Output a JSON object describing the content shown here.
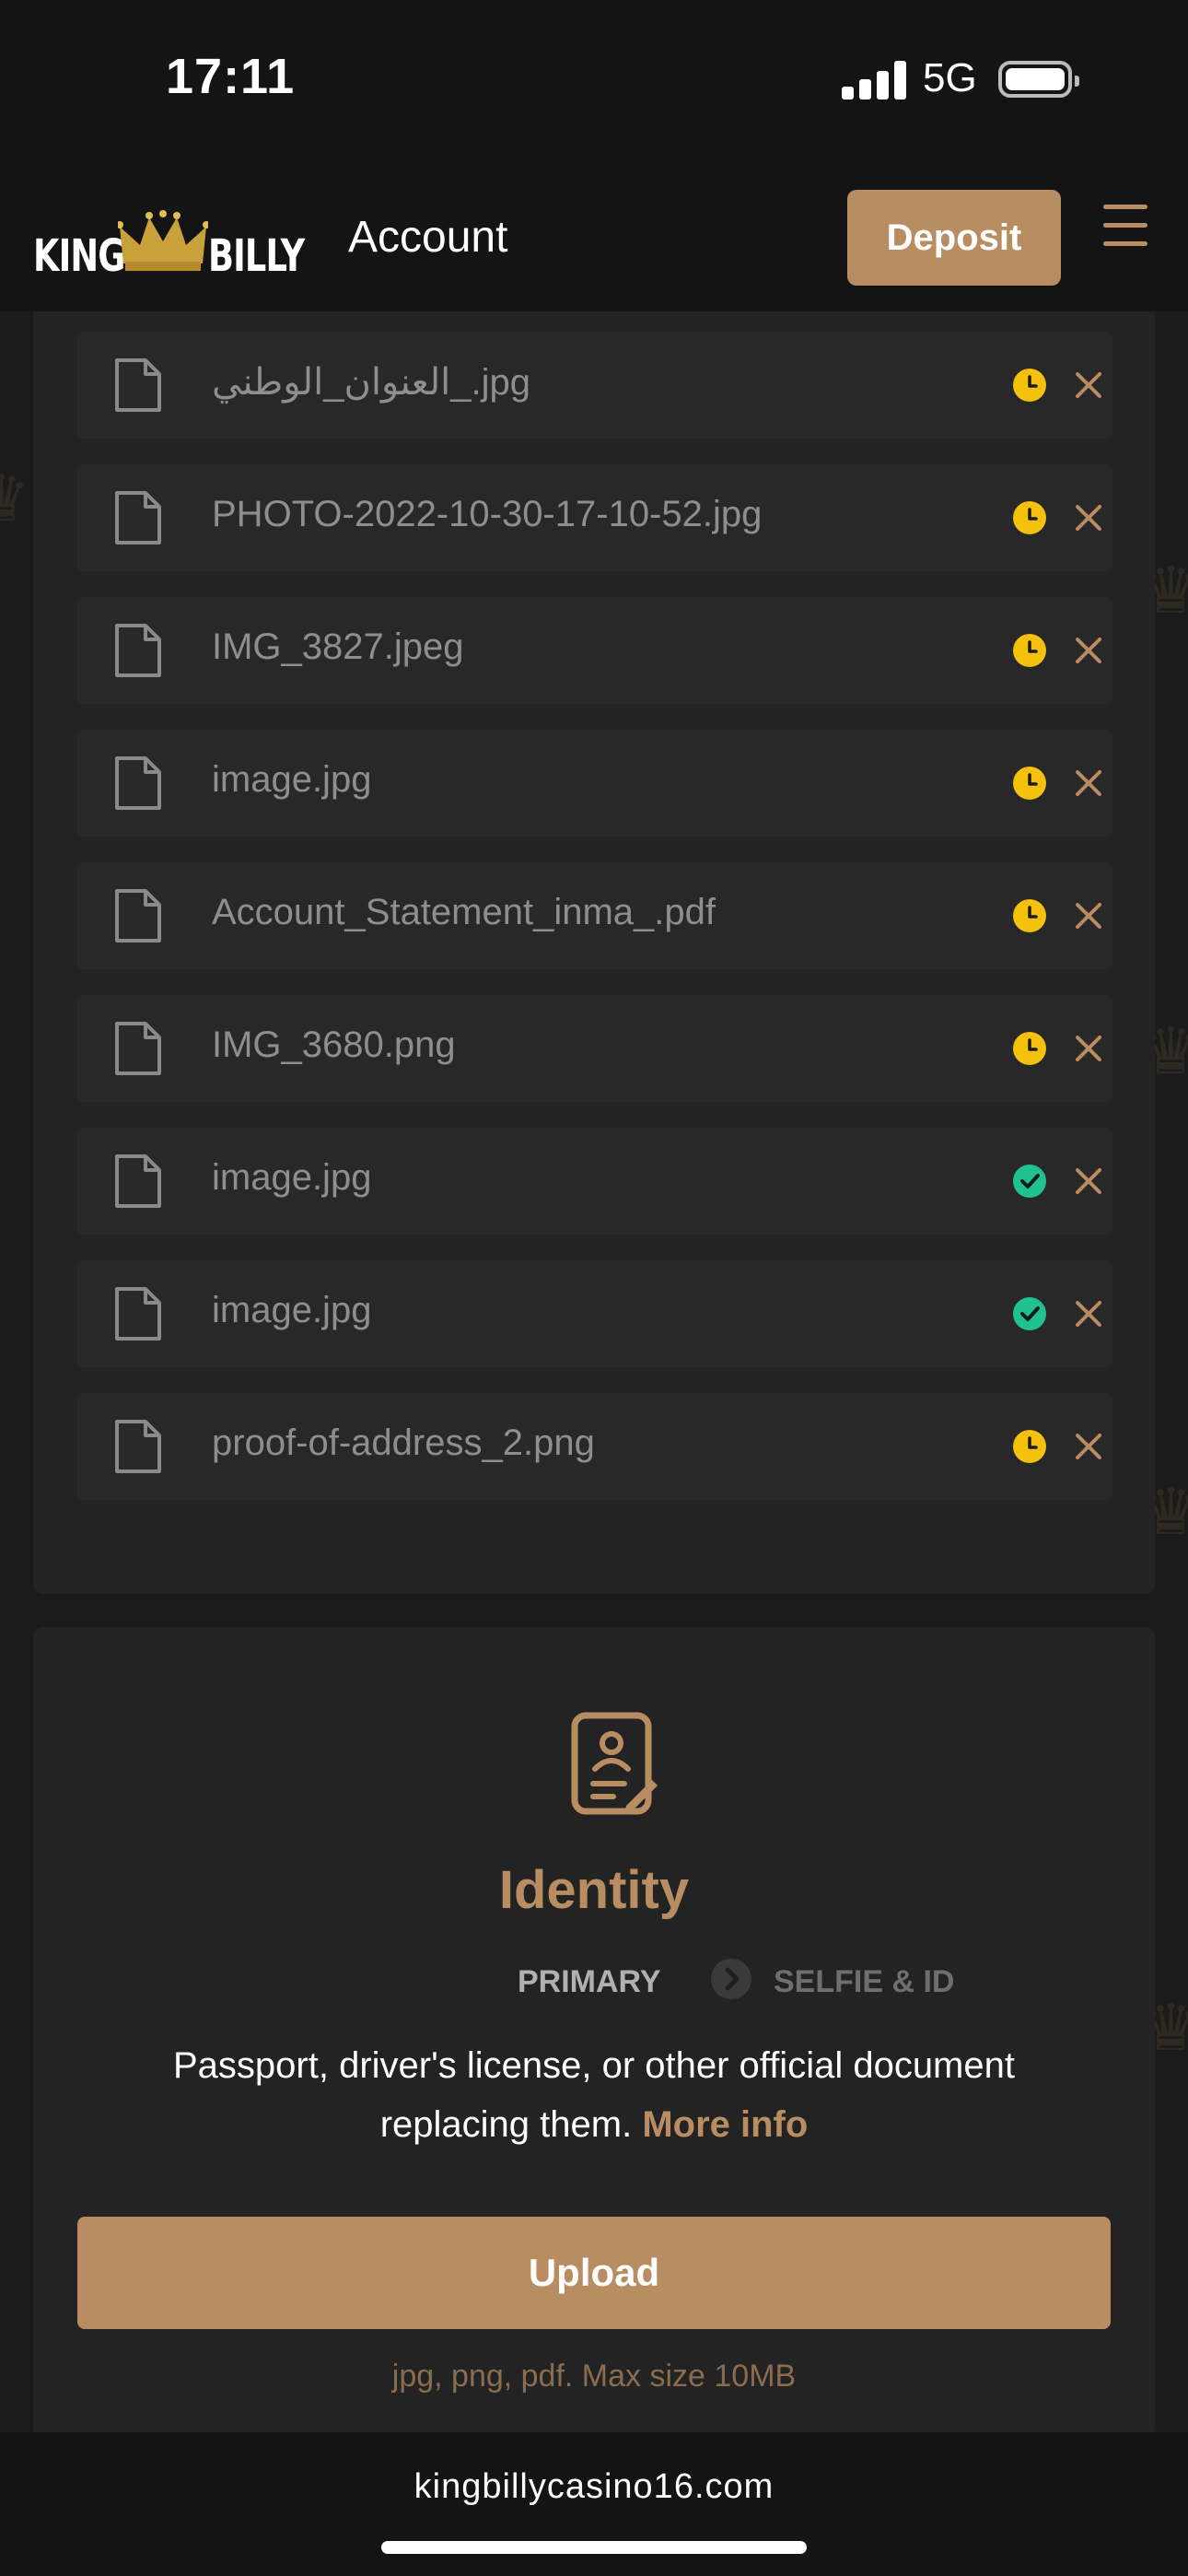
{
  "status_bar": {
    "time": "17:11",
    "network": "5G"
  },
  "header": {
    "logo_left": "KING",
    "logo_right": "BILLY",
    "title": "Account",
    "deposit_label": "Deposit"
  },
  "colors": {
    "accent": "#b98d62",
    "pending": "#f4c20d",
    "approved": "#1fc28e",
    "card": "#232323",
    "row": "#282828"
  },
  "files": [
    {
      "name": "العنوان_الوطني_.jpg",
      "status": "pending"
    },
    {
      "name": "العنوان_الوطني_.jpg",
      "status": "pending"
    },
    {
      "name": "PHOTO-2022-10-30-17-10-52.jpg",
      "status": "pending"
    },
    {
      "name": "IMG_3827.jpeg",
      "status": "pending"
    },
    {
      "name": "image.jpg",
      "status": "pending"
    },
    {
      "name": "Account_Statement_inma_.pdf",
      "status": "pending"
    },
    {
      "name": "IMG_3680.png",
      "status": "pending"
    },
    {
      "name": "image.jpg",
      "status": "approved"
    },
    {
      "name": "image.jpg",
      "status": "approved"
    },
    {
      "name": "proof-of-address_2.png",
      "status": "pending"
    }
  ],
  "identity": {
    "title": "Identity",
    "step_primary": "PRIMARY",
    "step_selfie": "SELFIE & ID",
    "description": "Passport, driver's license, or other official document replacing them.",
    "more_info": "More info",
    "upload_label": "Upload",
    "hint": "jpg, png, pdf. Max size 10MB"
  },
  "browser": {
    "url": "kingbillycasino16.com"
  }
}
